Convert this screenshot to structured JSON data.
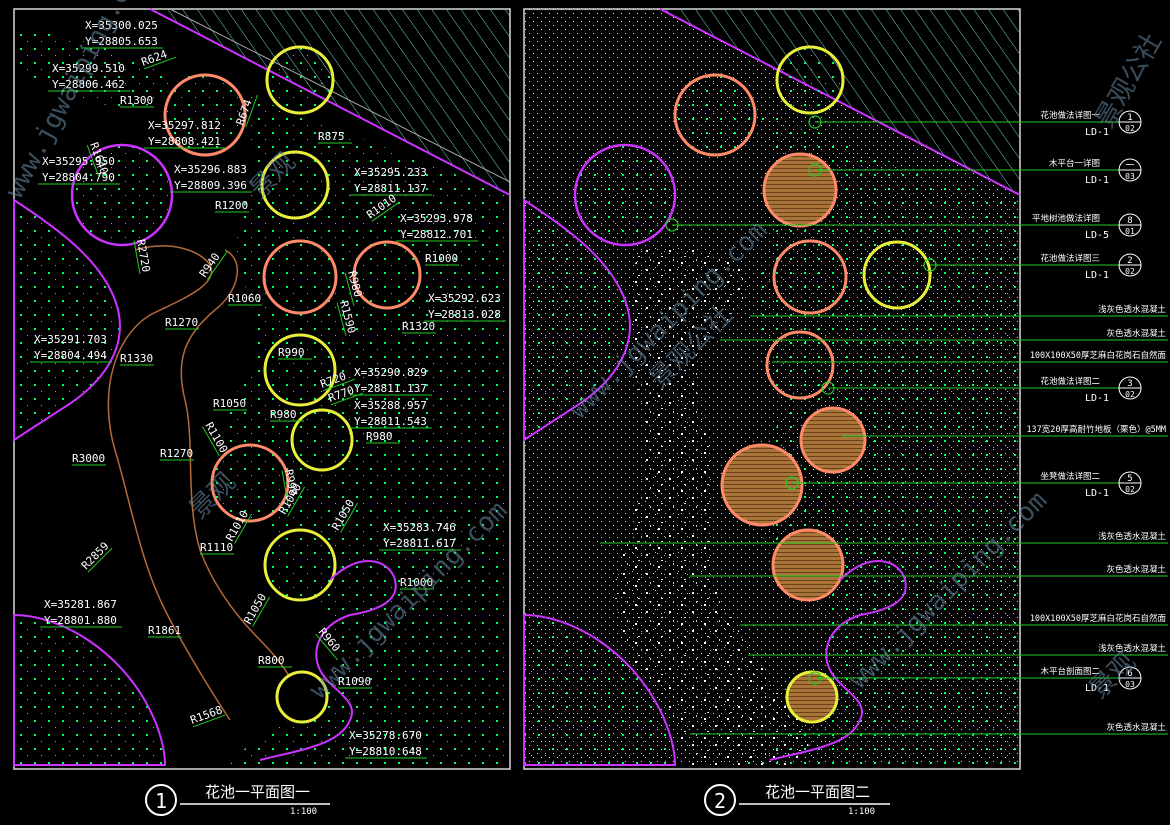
{
  "colors": {
    "background": "#000000",
    "frame": "#d8d8d8",
    "hatch": "#7ad6c8",
    "dot_green": "#00ff66",
    "magenta": "#cc33ff",
    "brown": "#b36a3a",
    "salmon": "#ff8a6a",
    "yellow": "#e8f03a",
    "leader": "#22cc22",
    "label": "#ffffff",
    "watermark": "#6c8fa8"
  },
  "left_panel": {
    "coords": [
      "X=35300.025",
      "Y=28805.653",
      "X=35299.510",
      "Y=28806.462",
      "X=35297.812",
      "Y=28808.421",
      "X=35295.950",
      "Y=28804.790",
      "X=35296.883",
      "Y=28809.396",
      "X=35295.233",
      "Y=28811.137",
      "X=35293.978",
      "Y=28812.701",
      "X=35292.623",
      "Y=28813.028",
      "X=35291.703",
      "Y=28804.494",
      "X=35290.829",
      "Y=28811.137",
      "X=35288.957",
      "Y=28811.543",
      "X=35283.746",
      "Y=28811.617",
      "X=35281.867",
      "Y=28801.880",
      "X=35278.670",
      "Y=28810.648"
    ],
    "radii": [
      "R624",
      "R1300",
      "R674",
      "R875",
      "R1640",
      "R1200",
      "R1010",
      "R2720",
      "R940",
      "R1000",
      "R980",
      "R1590",
      "R1060",
      "R1320",
      "R1270",
      "R1330",
      "R990",
      "R720",
      "R770",
      "R1050",
      "R980",
      "R980",
      "R1100",
      "R1270",
      "R3000",
      "R990",
      "R1040",
      "R1010",
      "R1050",
      "R1110",
      "R1000",
      "R2859",
      "R1050",
      "R960",
      "R1861",
      "R800",
      "R1090",
      "R1568"
    ],
    "title_number": "1",
    "title": "花池一平面图一",
    "scale": "1:100"
  },
  "right_panel": {
    "callouts": [
      {
        "text": "花池做法详图一",
        "num": "1",
        "sheet": "LD-1",
        "page": "02"
      },
      {
        "text": "木平台一详图",
        "num": "一",
        "sheet": "LD-1",
        "page": "03"
      },
      {
        "text": "平地树池做法详图",
        "num": "8",
        "sheet": "LD-5",
        "page": "01"
      },
      {
        "text": "花池做法详图三",
        "num": "2",
        "sheet": "LD-1",
        "page": "02"
      },
      {
        "text": "浅灰色透水混凝土",
        "num": "",
        "sheet": "",
        "page": ""
      },
      {
        "text": "灰色透水混凝土",
        "num": "",
        "sheet": "",
        "page": ""
      },
      {
        "text": "100X100X50厚芝麻白花岗石自然面",
        "num": "",
        "sheet": "",
        "page": ""
      },
      {
        "text": "花池做法详图二",
        "num": "3",
        "sheet": "LD-1",
        "page": "02"
      },
      {
        "text": "137宽20厚高耐竹地板（栗色）@5MM",
        "num": "",
        "sheet": "",
        "page": ""
      },
      {
        "text": "坐凳做法详图二",
        "num": "5",
        "sheet": "LD-1",
        "page": "02"
      },
      {
        "text": "浅灰色透水混凝土",
        "num": "",
        "sheet": "",
        "page": ""
      },
      {
        "text": "灰色透水混凝土",
        "num": "",
        "sheet": "",
        "page": ""
      },
      {
        "text": "100X100X50厚芝麻白花岗石自然面",
        "num": "",
        "sheet": "",
        "page": ""
      },
      {
        "text": "浅灰色透水混凝土",
        "num": "",
        "sheet": "",
        "page": ""
      },
      {
        "text": "木平台剖面图二",
        "num": "6",
        "sheet": "LD-1",
        "page": "03"
      },
      {
        "text": "灰色透水混凝土",
        "num": "",
        "sheet": "",
        "page": ""
      }
    ],
    "title_number": "2",
    "title": "花池一平面图二",
    "scale": "1:100"
  },
  "watermark": {
    "brand": "景观",
    "site": "www.jgwaiping.com",
    "company": "景观公社"
  }
}
